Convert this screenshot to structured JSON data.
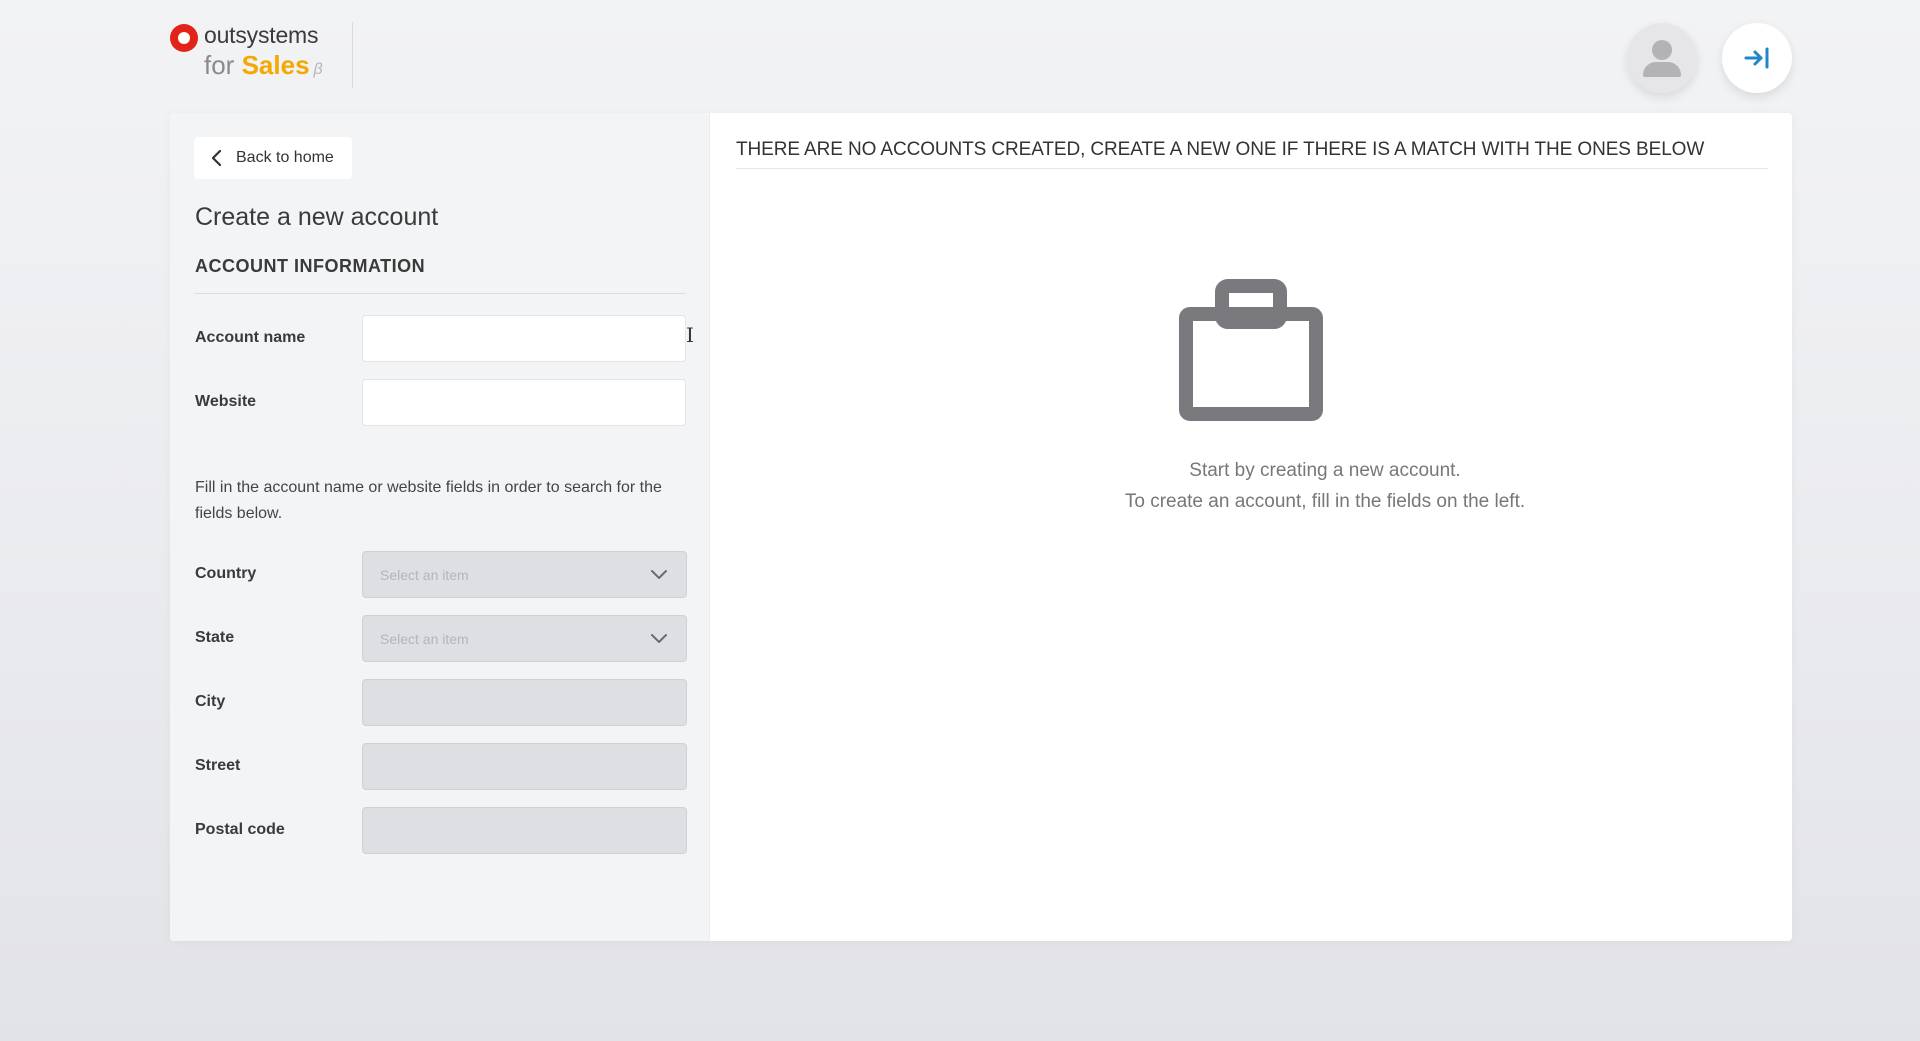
{
  "header": {
    "logo": {
      "line1": "outsystems",
      "line2_prefix": "for ",
      "line2_brand": "Sales",
      "beta_mark": "β"
    },
    "avatar_icon": "user-avatar-icon",
    "logout_icon": "logout-arrow-icon"
  },
  "sidebar": {
    "back_label": "Back to home",
    "page_title": "Create a new account",
    "section_title": "ACCOUNT INFORMATION",
    "fields": {
      "account_name": {
        "label": "Account name",
        "value": "",
        "placeholder": ""
      },
      "website": {
        "label": "Website",
        "value": "",
        "placeholder": ""
      }
    },
    "help_text": "Fill in the account name or website fields in order to search for the fields below.",
    "location": {
      "country": {
        "label": "Country",
        "placeholder": "Select an item"
      },
      "state": {
        "label": "State",
        "placeholder": "Select an item"
      },
      "city": {
        "label": "City"
      },
      "street": {
        "label": "Street"
      },
      "postal_code": {
        "label": "Postal code"
      }
    }
  },
  "main": {
    "header": "THERE ARE NO ACCOUNTS CREATED, CREATE A NEW ONE IF THERE IS A MATCH WITH THE ONES BELOW",
    "empty_state": {
      "icon": "briefcase-icon",
      "line1": "Start by creating a new account.",
      "line2": "To create an account, fill in the fields on the left."
    }
  },
  "colors": {
    "brand_red": "#e2231a",
    "brand_yellow": "#f5a800",
    "accent_blue": "#1f86c8",
    "panel_bg": "#f3f4f6",
    "disabled_bg": "#dedfe2",
    "icon_grey": "#7a7a7e"
  }
}
